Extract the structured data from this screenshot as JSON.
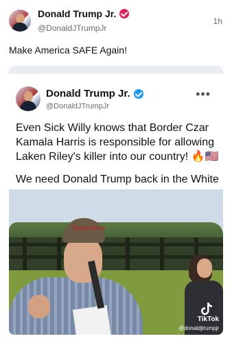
{
  "author": {
    "name": "Donald Trump Jr.",
    "handle": "@DonaldJTrumpJr",
    "verified_color": "#e0245e",
    "avatar_icon": "avatar-photo"
  },
  "timestamp": "1h",
  "post": {
    "text": "Make America SAFE Again!"
  },
  "embedded": {
    "name": "Donald Trump Jr.",
    "handle": "@DonaldJTrumpJr",
    "verified_color": "#1d9bf0",
    "more_icon": "more-horizontal-icon",
    "more_glyph": "•••",
    "paragraph1": "Even Sick Willy knows that Border Czar Kamala Harris is responsible for allowing Laken Riley's killer into our country! 🔥🇺🇸",
    "paragraph2": "We need Donald Trump back in the White House to MAKE AMERICA SAFE AGAIN!"
  },
  "video": {
    "cap_text": "TRUMP MAGA",
    "watermark_label": "TikTok",
    "watermark_user": "@donaldjtrumpjr",
    "logo_icon": "tiktok-logo-icon"
  }
}
